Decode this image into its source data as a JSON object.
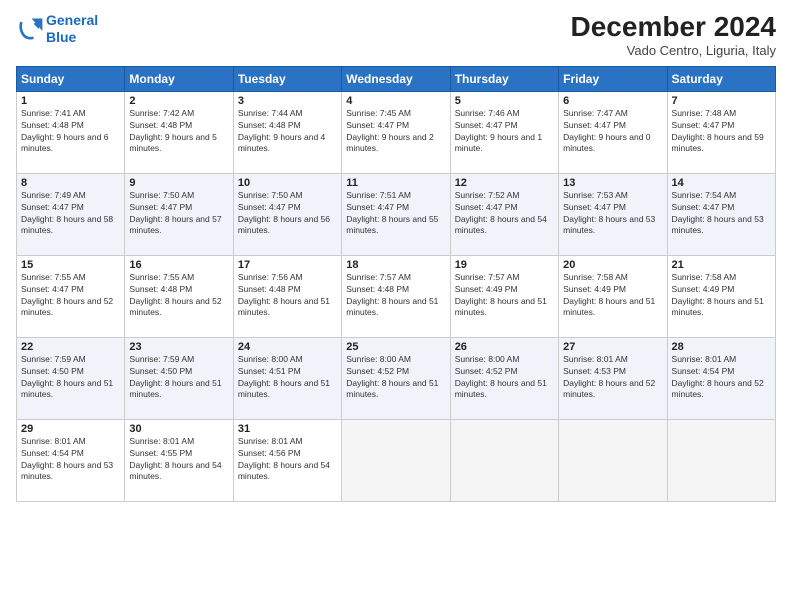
{
  "header": {
    "logo_line1": "General",
    "logo_line2": "Blue",
    "month": "December 2024",
    "location": "Vado Centro, Liguria, Italy"
  },
  "days_of_week": [
    "Sunday",
    "Monday",
    "Tuesday",
    "Wednesday",
    "Thursday",
    "Friday",
    "Saturday"
  ],
  "weeks": [
    [
      {
        "day": "1",
        "sunrise": "7:41 AM",
        "sunset": "4:48 PM",
        "daylight": "9 hours and 6 minutes."
      },
      {
        "day": "2",
        "sunrise": "7:42 AM",
        "sunset": "4:48 PM",
        "daylight": "9 hours and 5 minutes."
      },
      {
        "day": "3",
        "sunrise": "7:44 AM",
        "sunset": "4:48 PM",
        "daylight": "9 hours and 4 minutes."
      },
      {
        "day": "4",
        "sunrise": "7:45 AM",
        "sunset": "4:47 PM",
        "daylight": "9 hours and 2 minutes."
      },
      {
        "day": "5",
        "sunrise": "7:46 AM",
        "sunset": "4:47 PM",
        "daylight": "9 hours and 1 minute."
      },
      {
        "day": "6",
        "sunrise": "7:47 AM",
        "sunset": "4:47 PM",
        "daylight": "9 hours and 0 minutes."
      },
      {
        "day": "7",
        "sunrise": "7:48 AM",
        "sunset": "4:47 PM",
        "daylight": "8 hours and 59 minutes."
      }
    ],
    [
      {
        "day": "8",
        "sunrise": "7:49 AM",
        "sunset": "4:47 PM",
        "daylight": "8 hours and 58 minutes."
      },
      {
        "day": "9",
        "sunrise": "7:50 AM",
        "sunset": "4:47 PM",
        "daylight": "8 hours and 57 minutes."
      },
      {
        "day": "10",
        "sunrise": "7:50 AM",
        "sunset": "4:47 PM",
        "daylight": "8 hours and 56 minutes."
      },
      {
        "day": "11",
        "sunrise": "7:51 AM",
        "sunset": "4:47 PM",
        "daylight": "8 hours and 55 minutes."
      },
      {
        "day": "12",
        "sunrise": "7:52 AM",
        "sunset": "4:47 PM",
        "daylight": "8 hours and 54 minutes."
      },
      {
        "day": "13",
        "sunrise": "7:53 AM",
        "sunset": "4:47 PM",
        "daylight": "8 hours and 53 minutes."
      },
      {
        "day": "14",
        "sunrise": "7:54 AM",
        "sunset": "4:47 PM",
        "daylight": "8 hours and 53 minutes."
      }
    ],
    [
      {
        "day": "15",
        "sunrise": "7:55 AM",
        "sunset": "4:47 PM",
        "daylight": "8 hours and 52 minutes."
      },
      {
        "day": "16",
        "sunrise": "7:55 AM",
        "sunset": "4:48 PM",
        "daylight": "8 hours and 52 minutes."
      },
      {
        "day": "17",
        "sunrise": "7:56 AM",
        "sunset": "4:48 PM",
        "daylight": "8 hours and 51 minutes."
      },
      {
        "day": "18",
        "sunrise": "7:57 AM",
        "sunset": "4:48 PM",
        "daylight": "8 hours and 51 minutes."
      },
      {
        "day": "19",
        "sunrise": "7:57 AM",
        "sunset": "4:49 PM",
        "daylight": "8 hours and 51 minutes."
      },
      {
        "day": "20",
        "sunrise": "7:58 AM",
        "sunset": "4:49 PM",
        "daylight": "8 hours and 51 minutes."
      },
      {
        "day": "21",
        "sunrise": "7:58 AM",
        "sunset": "4:49 PM",
        "daylight": "8 hours and 51 minutes."
      }
    ],
    [
      {
        "day": "22",
        "sunrise": "7:59 AM",
        "sunset": "4:50 PM",
        "daylight": "8 hours and 51 minutes."
      },
      {
        "day": "23",
        "sunrise": "7:59 AM",
        "sunset": "4:50 PM",
        "daylight": "8 hours and 51 minutes."
      },
      {
        "day": "24",
        "sunrise": "8:00 AM",
        "sunset": "4:51 PM",
        "daylight": "8 hours and 51 minutes."
      },
      {
        "day": "25",
        "sunrise": "8:00 AM",
        "sunset": "4:52 PM",
        "daylight": "8 hours and 51 minutes."
      },
      {
        "day": "26",
        "sunrise": "8:00 AM",
        "sunset": "4:52 PM",
        "daylight": "8 hours and 51 minutes."
      },
      {
        "day": "27",
        "sunrise": "8:01 AM",
        "sunset": "4:53 PM",
        "daylight": "8 hours and 52 minutes."
      },
      {
        "day": "28",
        "sunrise": "8:01 AM",
        "sunset": "4:54 PM",
        "daylight": "8 hours and 52 minutes."
      }
    ],
    [
      {
        "day": "29",
        "sunrise": "8:01 AM",
        "sunset": "4:54 PM",
        "daylight": "8 hours and 53 minutes."
      },
      {
        "day": "30",
        "sunrise": "8:01 AM",
        "sunset": "4:55 PM",
        "daylight": "8 hours and 54 minutes."
      },
      {
        "day": "31",
        "sunrise": "8:01 AM",
        "sunset": "4:56 PM",
        "daylight": "8 hours and 54 minutes."
      },
      null,
      null,
      null,
      null
    ]
  ]
}
